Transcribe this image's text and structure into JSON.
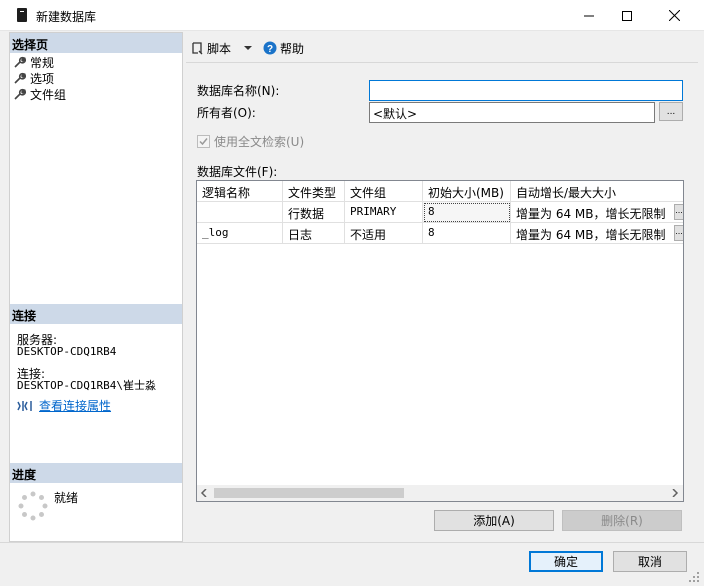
{
  "window": {
    "title": "新建数据库",
    "minimize_glyph": "—",
    "maximize_glyph": "☐",
    "close_glyph": "✕"
  },
  "left": {
    "select_page_header": "选择页",
    "pages": [
      {
        "label": "常规",
        "icon": "wrench-icon"
      },
      {
        "label": "选项",
        "icon": "wrench-icon"
      },
      {
        "label": "文件组",
        "icon": "wrench-icon"
      }
    ],
    "connection_header": "连接",
    "server_label": "服务器:",
    "server_value": "DESKTOP-CDQ1RB4",
    "connection_label": "连接:",
    "connection_value": "DESKTOP-CDQ1RB4\\崔士淼",
    "view_props_link": "查看连接属性",
    "progress_header": "进度",
    "progress_status": "就绪"
  },
  "toolbar": {
    "script_label": "脚本",
    "help_label": "帮助"
  },
  "form": {
    "db_name_label": "数据库名称(N):",
    "db_name_value": "",
    "owner_label": "所有者(O):",
    "owner_value": "<默认>",
    "owner_browse": "...",
    "fulltext_label": "使用全文检索(U)",
    "fulltext_checked": true,
    "files_label": "数据库文件(F):"
  },
  "grid": {
    "columns": [
      "逻辑名称",
      "文件类型",
      "文件组",
      "初始大小(MB)",
      "自动增长/最大大小"
    ],
    "rows": [
      {
        "logical": "",
        "type": "行数据",
        "group": "PRIMARY",
        "size": "8",
        "growth": "增量为 64 MB，增长无限制"
      },
      {
        "logical": "_log",
        "type": "日志",
        "group": "不适用",
        "size": "8",
        "growth": "增量为 64 MB，增长无限制"
      }
    ],
    "row_button": "..."
  },
  "actions": {
    "add_label": "添加(A)",
    "remove_label": "删除(R)",
    "ok_label": "确定",
    "cancel_label": "取消"
  }
}
